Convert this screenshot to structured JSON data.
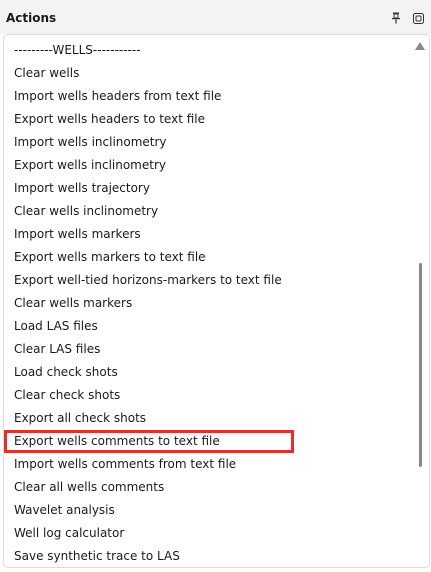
{
  "header": {
    "title": "Actions",
    "pin_icon": "pin-icon",
    "float_icon": "float-window-icon"
  },
  "actions": {
    "items": [
      "---------WELLS-----------",
      "Clear wells",
      "Import wells headers from text file",
      "Export wells headers to text file",
      "Import wells inclinometry",
      "Export wells inclinometry",
      "Import wells trajectory",
      "Clear wells inclinometry",
      "Import wells markers",
      "Export wells markers to text file",
      "Export well-tied horizons-markers to text file",
      "Clear wells markers",
      "Load LAS files",
      "Clear LAS files",
      "Load check shots",
      "Clear check shots",
      "Export all check shots",
      "Export wells comments to text file",
      "Import wells comments from text file",
      "Clear all wells comments",
      "Wavelet analysis",
      "Well log calculator",
      "Save synthetic trace to LAS"
    ],
    "selected_index": 17,
    "highlight_color": "#e03030"
  }
}
